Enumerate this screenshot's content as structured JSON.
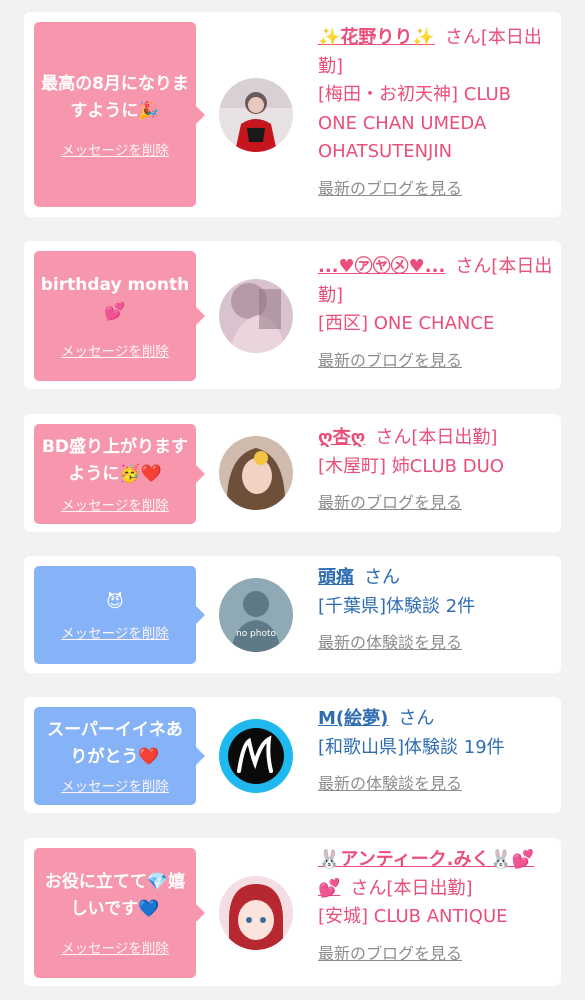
{
  "items": [
    {
      "message": "最高の8月になりますように🎉",
      "delete_label": "メッセージを削除",
      "name": "✨花野りり✨",
      "honorific": "さん[本日出勤]",
      "detail": "[梅田・お初天神] CLUB ONE CHAN UMEDA OHATSUTENJIN",
      "link": "最新のブログを見る",
      "theme": "pink"
    },
    {
      "message": "birthday month💕",
      "delete_label": "メッセージを削除",
      "name": "...♥㋐㋳㋱♥...",
      "honorific": "さん[本日出勤]",
      "detail": "[西区] ONE CHANCE",
      "link": "最新のブログを見る",
      "theme": "pink"
    },
    {
      "message": "BD盛り上がりますように🥳❤️",
      "delete_label": "メッセージを削除",
      "name": "ღ杏ღ",
      "honorific": "さん[本日出勤]",
      "detail": "[木屋町] 姉CLUB DUO",
      "link": "最新のブログを見る",
      "theme": "pink"
    },
    {
      "message": "😈",
      "delete_label": "メッセージを削除",
      "name": "頭痛",
      "honorific": "さん",
      "detail": "[千葉県]体験談 2件",
      "link": "最新の体験談を見る",
      "avatar_text": "no photo",
      "theme": "blue"
    },
    {
      "message": "スーパーイイネありがとう❤️",
      "delete_label": "メッセージを削除",
      "name": "M(絵夢)",
      "honorific": "さん",
      "detail": "[和歌山県]体験談 19件",
      "link": "最新の体験談を見る",
      "theme": "blue"
    },
    {
      "message": "お役に立てて💎嬉しいです💙",
      "delete_label": "メッセージを削除",
      "name": "🐰アンティーク.みく🐰💕💕",
      "honorific": "さん[本日出勤]",
      "detail": "[安城] CLUB ANTIQUE",
      "link": "最新のブログを見る",
      "theme": "pink"
    }
  ],
  "colors": {
    "pink_bubble": "#f797ad",
    "blue_bubble": "#86b3f7",
    "pink_text": "#ea4f7b",
    "blue_text": "#2f6db3",
    "link_gray": "#8d8d8d"
  }
}
